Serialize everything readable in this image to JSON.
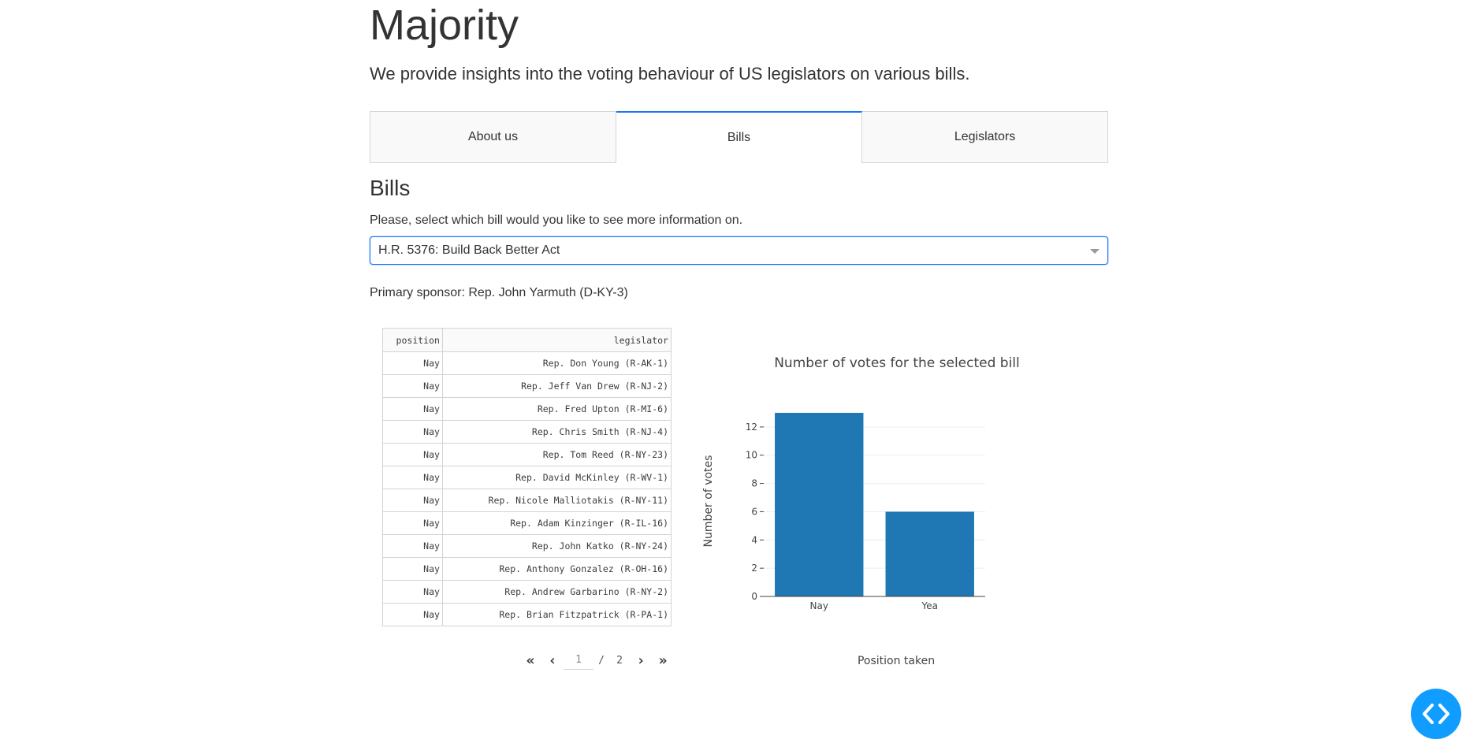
{
  "app": {
    "title": "Majority",
    "subtitle": "We provide insights into the voting behaviour of US legislators on various bills."
  },
  "tabs": [
    {
      "label": "About us",
      "active": false
    },
    {
      "label": "Bills",
      "active": true
    },
    {
      "label": "Legislators",
      "active": false
    }
  ],
  "bills": {
    "section_title": "Bills",
    "prompt": "Please, select which bill would you like to see more information on.",
    "selected_bill": "H.R. 5376: Build Back Better Act",
    "sponsor": "Primary sponsor: Rep. John Yarmuth (D-KY-3)"
  },
  "table": {
    "headers": {
      "position": "position",
      "legislator": "legislator"
    },
    "rows": [
      {
        "position": "Nay",
        "legislator": "Rep. Don Young (R-AK-1)"
      },
      {
        "position": "Nay",
        "legislator": "Rep. Jeff Van Drew (R-NJ-2)"
      },
      {
        "position": "Nay",
        "legislator": "Rep. Fred Upton (R-MI-6)"
      },
      {
        "position": "Nay",
        "legislator": "Rep. Chris Smith (R-NJ-4)"
      },
      {
        "position": "Nay",
        "legislator": "Rep. Tom Reed (R-NY-23)"
      },
      {
        "position": "Nay",
        "legislator": "Rep. David McKinley (R-WV-1)"
      },
      {
        "position": "Nay",
        "legislator": "Rep. Nicole Malliotakis (R-NY-11)"
      },
      {
        "position": "Nay",
        "legislator": "Rep. Adam Kinzinger (R-IL-16)"
      },
      {
        "position": "Nay",
        "legislator": "Rep. John Katko (R-NY-24)"
      },
      {
        "position": "Nay",
        "legislator": "Rep. Anthony Gonzalez (R-OH-16)"
      },
      {
        "position": "Nay",
        "legislator": "Rep. Andrew Garbarino (R-NY-2)"
      },
      {
        "position": "Nay",
        "legislator": "Rep. Brian Fitzpatrick (R-PA-1)"
      }
    ]
  },
  "pagination": {
    "first": "«",
    "prev": "‹",
    "current": "1",
    "separator": "/",
    "total": "2",
    "next": "›",
    "last": "»"
  },
  "chart_data": {
    "type": "bar",
    "title": "Number of votes for the selected bill",
    "xlabel": "Position taken",
    "ylabel": "Number of votes",
    "categories": [
      "Nay",
      "Yea"
    ],
    "values": [
      13,
      6
    ],
    "ylim": [
      0,
      13.5
    ],
    "yticks": [
      0,
      2,
      4,
      6,
      8,
      10,
      12
    ],
    "grid": true,
    "bar_color": "#1f77b4"
  },
  "colors": {
    "accent": "#1975fa",
    "fab": "#119dff"
  },
  "fab": {
    "icon": "code-icon"
  }
}
